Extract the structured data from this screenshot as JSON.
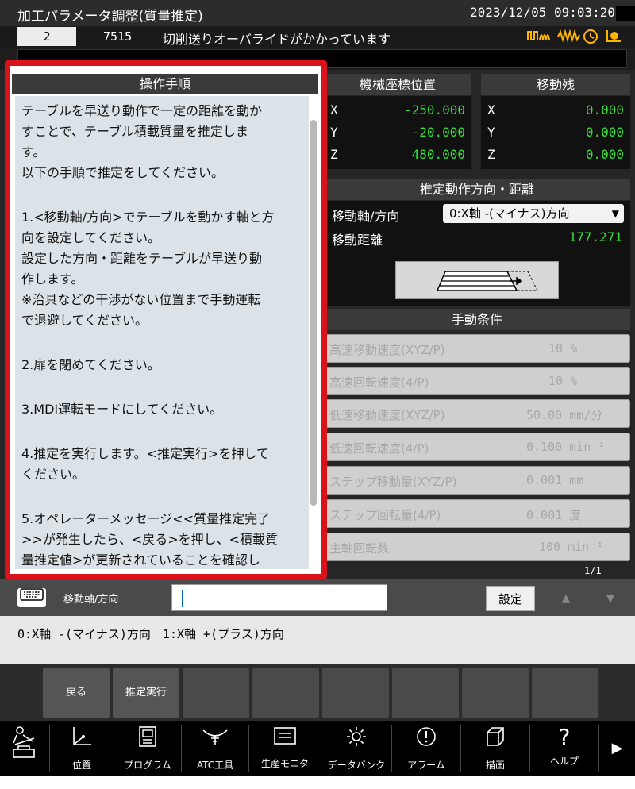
{
  "title": "加工パラメータ調整(質量推定)",
  "datetime": "2023/12/05 09:03:20",
  "message": {
    "number": "2",
    "code": "7515",
    "text": "切削送りオーバライドがかかっています"
  },
  "status_icons": [
    "spindle-wave-icon",
    "feed-wave-icon",
    "clock-icon",
    "signal-icon"
  ],
  "operation_steps": {
    "title": "操作手順",
    "lines": [
      "テーブルを早送り動作で一定の距離を動か",
      "すことで、テーブル積載質量を推定しま",
      "す。",
      "以下の手順で推定をしてください。",
      "",
      "1.<移動軸/方向>でテーブルを動かす軸と方",
      "向を設定してください。",
      "設定した方向・距離をテーブルが早送り動",
      "作します。",
      "※治具などの干渉がない位置まで手動運転",
      "で退避してください。",
      "",
      "2.扉を閉めてください。",
      "",
      "3.MDI運転モードにしてください。",
      "",
      "4.推定を実行します。<推定実行>を押して",
      "ください。",
      "",
      "5.オペレーターメッセージ<<質量推定完了",
      ">>が発生したら、<戻る>を押し、<積載質",
      "量推定値>が更新されていることを確認し"
    ]
  },
  "machine_coords": {
    "title": "機械座標位置",
    "rows": [
      {
        "axis": "X",
        "value": "-250.000"
      },
      {
        "axis": "Y",
        "value": "-20.000"
      },
      {
        "axis": "Z",
        "value": "480.000"
      }
    ]
  },
  "remaining": {
    "title": "移動残",
    "rows": [
      {
        "axis": "X",
        "value": "0.000"
      },
      {
        "axis": "Y",
        "value": "0.000"
      },
      {
        "axis": "Z",
        "value": "0.000"
      }
    ]
  },
  "estimation": {
    "title": "推定動作方向・距離",
    "direction_label": "移動軸/方向",
    "direction_value": "0:X軸 -(マイナス)方向",
    "distance_label": "移動距離",
    "distance_value": "177.271"
  },
  "manual": {
    "title": "手動条件",
    "rows": [
      {
        "label": "高速移動速度(XYZ/P)",
        "value": "10 %"
      },
      {
        "label": "高速回転速度(4/P)",
        "value": "10 %"
      },
      {
        "label": "低速移動速度(XYZ/P)",
        "value": "50.00 mm/分"
      },
      {
        "label": "低速回転速度(4/P)",
        "value": "0.100 min⁻¹"
      },
      {
        "label": "ステップ移動量(XYZ/P)",
        "value": "0.001 mm"
      },
      {
        "label": "ステップ回転量(4/P)",
        "value": "0.001 度"
      },
      {
        "label": "主軸回転数",
        "value": "100 min⁻¹"
      }
    ]
  },
  "pager": "1/1",
  "input": {
    "label": "移動軸/方向",
    "value": "",
    "set_label": "設定"
  },
  "options_text": "0:X軸 -(マイナス)方向　1:X軸 +(プラス)方向",
  "softkeys": [
    "戻る",
    "推定実行",
    "",
    "",
    "",
    "",
    "",
    "",
    ""
  ],
  "nav": [
    {
      "icon": "operator-icon",
      "label": ""
    },
    {
      "icon": "position-icon",
      "label": "位置"
    },
    {
      "icon": "program-icon",
      "label": "プログラム"
    },
    {
      "icon": "atc-tool-icon",
      "label": "ATC工具"
    },
    {
      "icon": "production-monitor-icon",
      "label": "生産モニタ"
    },
    {
      "icon": "data-bank-icon",
      "label": "データバンク"
    },
    {
      "icon": "alarm-icon",
      "label": "アラーム"
    },
    {
      "icon": "drawing-icon",
      "label": "描画"
    },
    {
      "icon": "help-icon",
      "label": "ヘルプ"
    }
  ],
  "colors": {
    "accent_green": "#36e03a",
    "highlight_red": "#d9131c",
    "status_orange": "#ffb400"
  }
}
